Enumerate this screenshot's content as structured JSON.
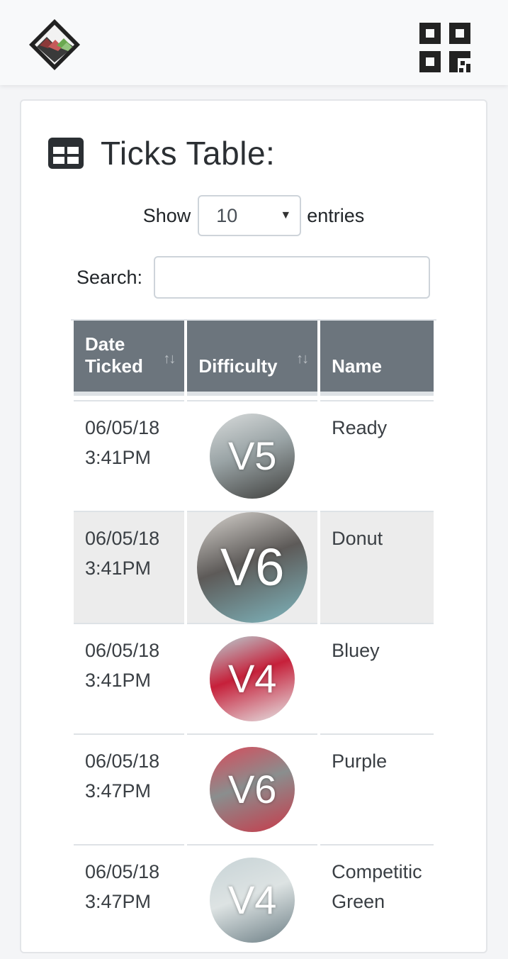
{
  "header": {
    "logo_icon": "mountain-logo-icon",
    "qr_icon": "qr-code-icon"
  },
  "card": {
    "title": "Ticks Table:",
    "title_icon": "table-icon",
    "length": {
      "show_label": "Show",
      "selected": "10",
      "entries_label": "entries"
    },
    "search": {
      "label": "Search:",
      "value": "",
      "placeholder": ""
    }
  },
  "table": {
    "columns": [
      {
        "label_line1": "Date",
        "label_line2": "Ticked"
      },
      {
        "label": "Difficulty"
      },
      {
        "label": "Name"
      }
    ],
    "rows": [
      {
        "date": "06/05/18",
        "time": "3:41PM",
        "grade": "V5",
        "name": "Ready",
        "photo_colors": [
          "#d9dcdc",
          "#3f3f3d",
          "#9aa4a6"
        ]
      },
      {
        "date": "06/05/18",
        "time": "3:41PM",
        "grade": "V6",
        "name": "Donut",
        "photo_colors": [
          "#d8d4cf",
          "#7fb7bf",
          "#5d5a58"
        ]
      },
      {
        "date": "06/05/18",
        "time": "3:41PM",
        "grade": "V4",
        "name": "Bluey",
        "photo_colors": [
          "#b9d4d7",
          "#e5e8e8",
          "#c6203a"
        ]
      },
      {
        "date": "06/05/18",
        "time": "3:47PM",
        "grade": "V6",
        "name": "Purple",
        "photo_colors": [
          "#d84a5a",
          "#c83a4a",
          "#8a8e8e"
        ]
      },
      {
        "date": "06/05/18",
        "time": "3:47PM",
        "grade": "V4",
        "name": "Competitic",
        "name_line2": "Green",
        "photo_colors": [
          "#c7d3d6",
          "#6d7f86",
          "#dde3e3"
        ]
      }
    ]
  },
  "colors": {
    "header_bg": "#6c757d",
    "stripe": "#ececec",
    "border": "#dee2e6"
  }
}
